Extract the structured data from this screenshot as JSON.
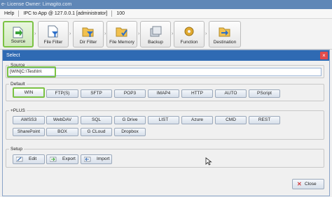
{
  "window": {
    "title": "e- License Owner: Limagito.com"
  },
  "menubar": {
    "help": "Help",
    "connection": "IPC to App @ 127.0.0.1 [administrator]",
    "count": "100"
  },
  "toolbar": {
    "items": [
      {
        "label": "Source",
        "icon": "source-icon",
        "active": true
      },
      {
        "label": "File Filter",
        "icon": "file-filter-icon"
      },
      {
        "label": "Dir Filter",
        "icon": "dir-filter-icon"
      },
      {
        "label": "File Memory",
        "icon": "file-memory-icon"
      },
      {
        "label": "Backup",
        "icon": "backup-icon"
      },
      {
        "label": "Function",
        "icon": "function-icon"
      },
      {
        "label": "Destination",
        "icon": "destination-icon"
      }
    ]
  },
  "dialog": {
    "title": "Select",
    "source_group_label": "Source",
    "source_value": "[WIN]C:\\Test\\In\\",
    "default_group_label": "Default",
    "default_buttons": [
      "WIN",
      "FTP(S)",
      "SFTP",
      "POP3",
      "IMAP4",
      "HTTP",
      "AUTO",
      "PScript"
    ],
    "plus_group_label": "+PLUS",
    "plus_row1": [
      "AWSS3",
      "WebDAV",
      "SQL",
      "G Drive",
      "LIST",
      "Azure",
      "CMD",
      "REST"
    ],
    "plus_row2": [
      "SharePoint",
      "BOX",
      "G CLoud",
      "Dropbox"
    ],
    "setup_group_label": "Setup",
    "setup_buttons": [
      "Edit",
      "Export",
      "Import"
    ],
    "close_label": "Close"
  },
  "colors": {
    "highlight": "#7bc244",
    "dialog_title_bg": "#2f6ab3",
    "titlebar_bg": "#5f87b7"
  }
}
